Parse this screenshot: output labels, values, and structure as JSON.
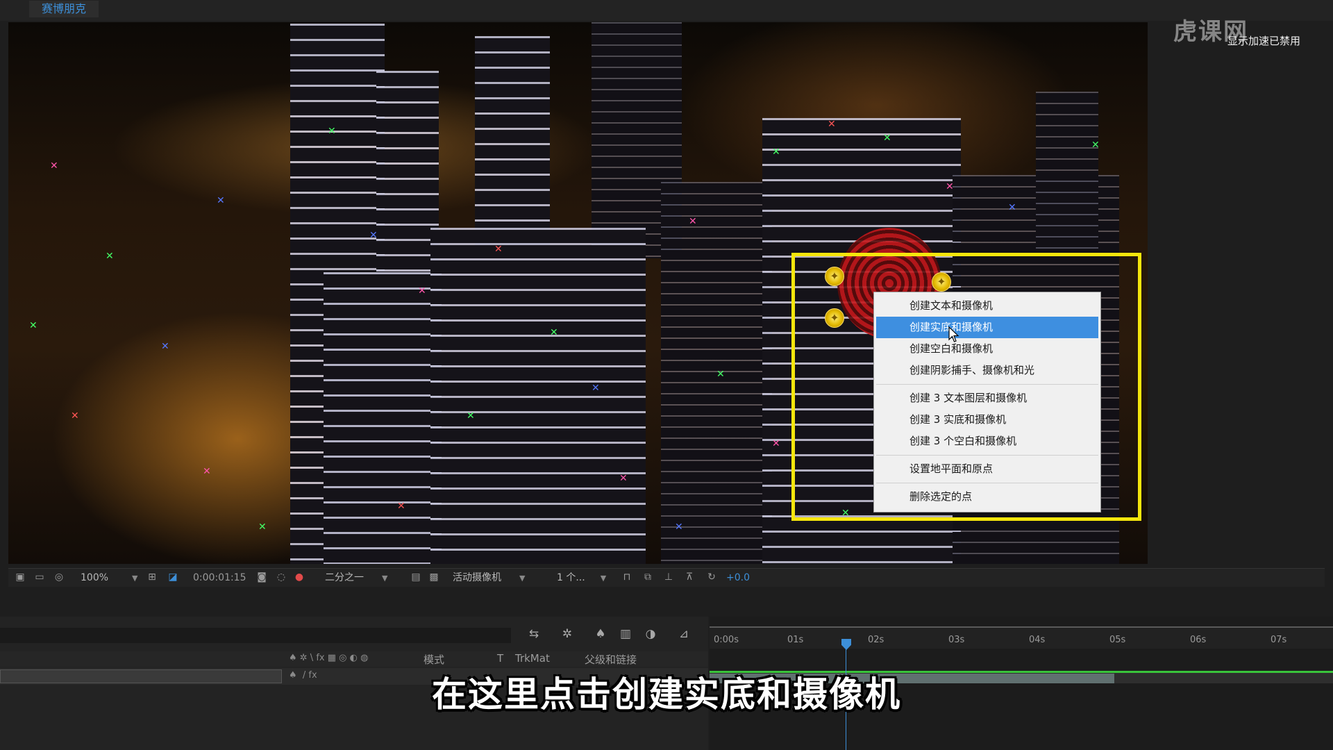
{
  "composition": {
    "tab_label": "赛博朋克"
  },
  "watermark": {
    "logo": "虎课网",
    "notice": "显示加速已禁用"
  },
  "context_menu": {
    "items": [
      {
        "label": "创建文本和摄像机",
        "selected": false
      },
      {
        "label": "创建实底和摄像机",
        "selected": true
      },
      {
        "label": "创建空白和摄像机",
        "selected": false
      },
      {
        "label": "创建阴影捕手、摄像机和光",
        "selected": false
      },
      {
        "label": "创建 3 文本图层和摄像机",
        "selected": false
      },
      {
        "label": "创建 3 实底和摄像机",
        "selected": false
      },
      {
        "label": "创建 3 个空白和摄像机",
        "selected": false
      },
      {
        "label": "设置地平面和原点",
        "selected": false
      },
      {
        "label": "删除选定的点",
        "selected": false
      }
    ]
  },
  "viewer_toolbar": {
    "zoom": "100%",
    "timecode": "0:00:01:15",
    "resolution": "二分之一",
    "camera": "活动摄像机",
    "views": "1 个...",
    "exposure": "+0.0"
  },
  "timeline": {
    "columns": {
      "mode": "模式",
      "trkmat_t": "T",
      "trkmat": "TrkMat",
      "parent": "父级和链接"
    },
    "ruler": [
      "0:00s",
      "01s",
      "02s",
      "03s",
      "04s",
      "05s",
      "06s",
      "07s"
    ]
  },
  "subtitle": "在这里点击创建实底和摄像机",
  "colors": {
    "accent": "#3d8fd8",
    "highlight_box": "#f6e60c",
    "menu_selected": "#3e8fe0"
  }
}
